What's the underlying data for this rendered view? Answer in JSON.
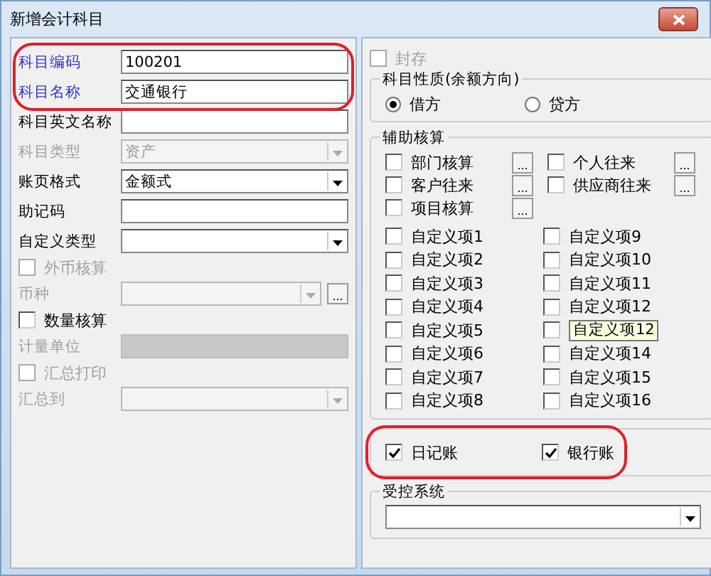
{
  "window": {
    "title": "新增会计科目"
  },
  "left_fields": [
    {
      "kind": "text",
      "label": "科目编码",
      "value": "100201",
      "required": true,
      "circled": true
    },
    {
      "kind": "text",
      "label": "科目名称",
      "value": "交通银行",
      "required": true,
      "circled": true
    },
    {
      "kind": "text",
      "label": "科目英文名称"
    },
    {
      "kind": "combo",
      "label": "科目类型",
      "value": "资产",
      "disabled": true
    },
    {
      "kind": "combo",
      "label": "账页格式",
      "value": "金额式",
      "disabled": false
    },
    {
      "kind": "text",
      "label": "助记码"
    },
    {
      "kind": "combo",
      "label": "自定义类型",
      "disabled": false
    },
    {
      "kind": "check",
      "label": "外币核算",
      "checked": false,
      "disabled": true
    },
    {
      "kind": "combo",
      "label": "币种",
      "disabled": true,
      "browse": "..."
    },
    {
      "kind": "check",
      "label": "数量核算",
      "checked": false,
      "disabled": false
    },
    {
      "kind": "text",
      "label": "计量单位",
      "disabled": true
    },
    {
      "kind": "check",
      "label": "汇总打印",
      "checked": false,
      "disabled": true
    },
    {
      "kind": "combo",
      "label": "汇总到",
      "disabled": true
    }
  ],
  "sealed": {
    "label": "封存",
    "checked": false,
    "disabled": true
  },
  "balance_direction": {
    "title": "科目性质(余额方向)",
    "options": [
      {
        "label": "借方",
        "selected": true
      },
      {
        "label": "贷方",
        "selected": false
      }
    ]
  },
  "auxiliary": {
    "title": "辅助核算",
    "items": [
      {
        "label": "部门核算",
        "checked": false,
        "browse": "..."
      },
      {
        "label": "个人往来",
        "checked": false,
        "browse": "..."
      },
      {
        "label": "客户往来",
        "checked": false,
        "browse": "..."
      },
      {
        "label": "供应商往来",
        "checked": false,
        "browse": "..."
      },
      {
        "label": "项目核算",
        "checked": false,
        "browse": "..."
      }
    ],
    "custom_left": [
      {
        "label": "自定义项1",
        "checked": false
      },
      {
        "label": "自定义项2",
        "checked": false
      },
      {
        "label": "自定义项3",
        "checked": false
      },
      {
        "label": "自定义项4",
        "checked": false
      },
      {
        "label": "自定义项5",
        "checked": false
      },
      {
        "label": "自定义项6",
        "checked": false
      },
      {
        "label": "自定义项7",
        "checked": false
      },
      {
        "label": "自定义项8",
        "checked": false
      }
    ],
    "custom_right": [
      {
        "label": "自定义项9",
        "checked": false
      },
      {
        "label": "自定义项10",
        "checked": false
      },
      {
        "label": "自定义项11",
        "checked": false
      },
      {
        "label": "自定义项12",
        "checked": false
      },
      {
        "checked": false,
        "tooltip": "自定义项12"
      },
      {
        "label": "自定义项14",
        "checked": false
      },
      {
        "label": "自定义项15",
        "checked": false
      },
      {
        "label": "自定义项16",
        "checked": false
      }
    ]
  },
  "books": {
    "circled": true,
    "items": [
      {
        "label": "日记账",
        "checked": true
      },
      {
        "label": "银行账",
        "checked": true
      }
    ]
  },
  "controlled_system": {
    "title": "受控系统"
  }
}
